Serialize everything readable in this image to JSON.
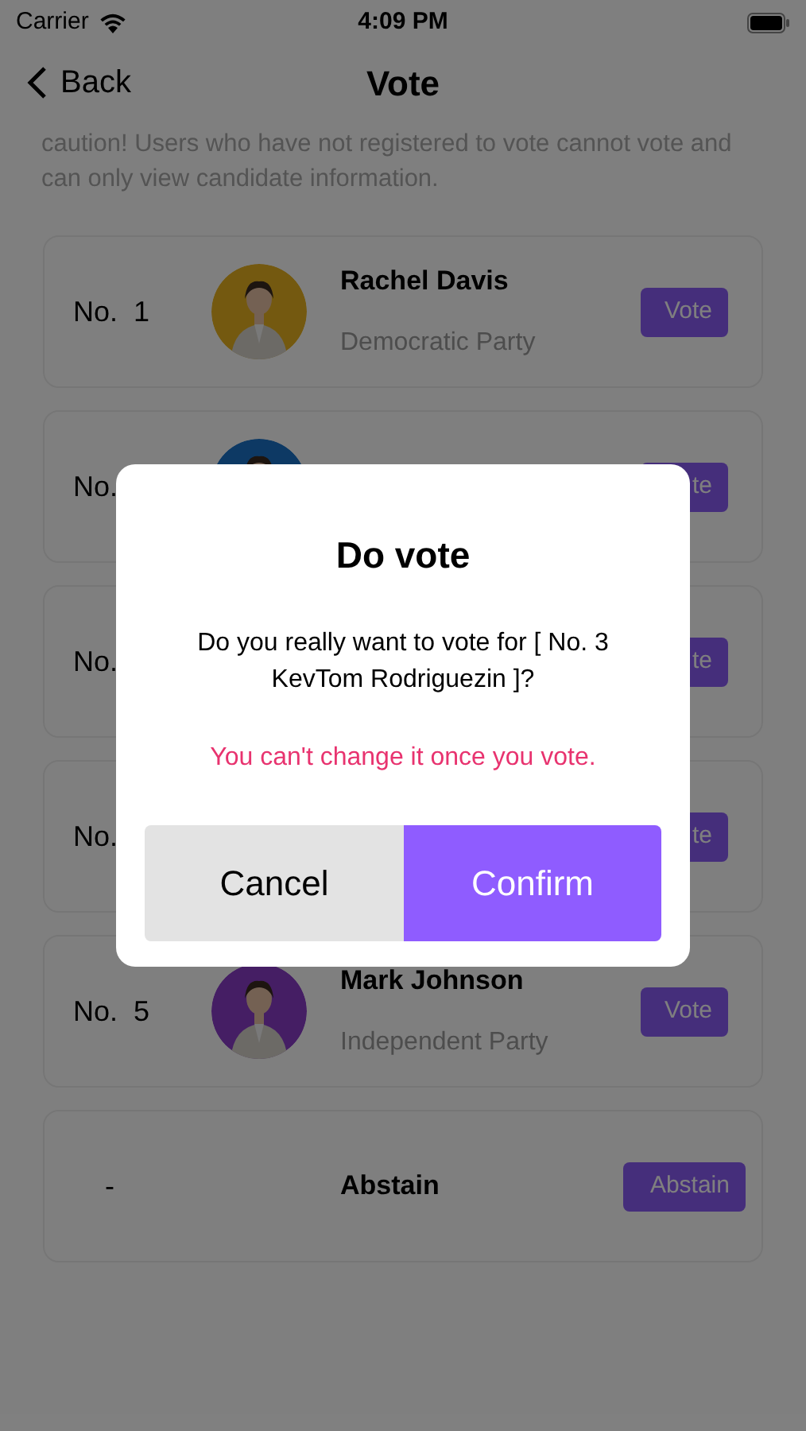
{
  "status_bar": {
    "carrier": "Carrier",
    "time": "4:09 PM"
  },
  "nav": {
    "back": "Back",
    "title": "Vote"
  },
  "notice": "caution! Users who have not registered to vote cannot vote and can only view candidate information.",
  "candidates": [
    {
      "kind": "candidate",
      "number": "No.  1",
      "name": "Rachel Davis",
      "party": "Democratic Party",
      "button": "Vote",
      "avatar": true
    },
    {
      "kind": "candidate",
      "number": "No.",
      "button": "te",
      "avatar": true
    },
    {
      "kind": "candidate",
      "number": "No.",
      "button": "te",
      "avatar": false
    },
    {
      "kind": "candidate",
      "number": "No.",
      "button": "te",
      "avatar": false
    },
    {
      "kind": "candidate",
      "number": "No.  5",
      "name": "Mark Johnson",
      "party": "Independent Party",
      "button": "Vote",
      "avatar": true
    },
    {
      "kind": "abstain",
      "number": "-",
      "name": "Abstain",
      "button": "Abstain"
    }
  ],
  "dialog": {
    "title": "Do vote",
    "message": "Do you really want to vote for [ No. 3 KevTom Rodriguezin ]?",
    "warning": "You can't change it once you vote.",
    "cancel": "Cancel",
    "confirm": "Confirm"
  }
}
